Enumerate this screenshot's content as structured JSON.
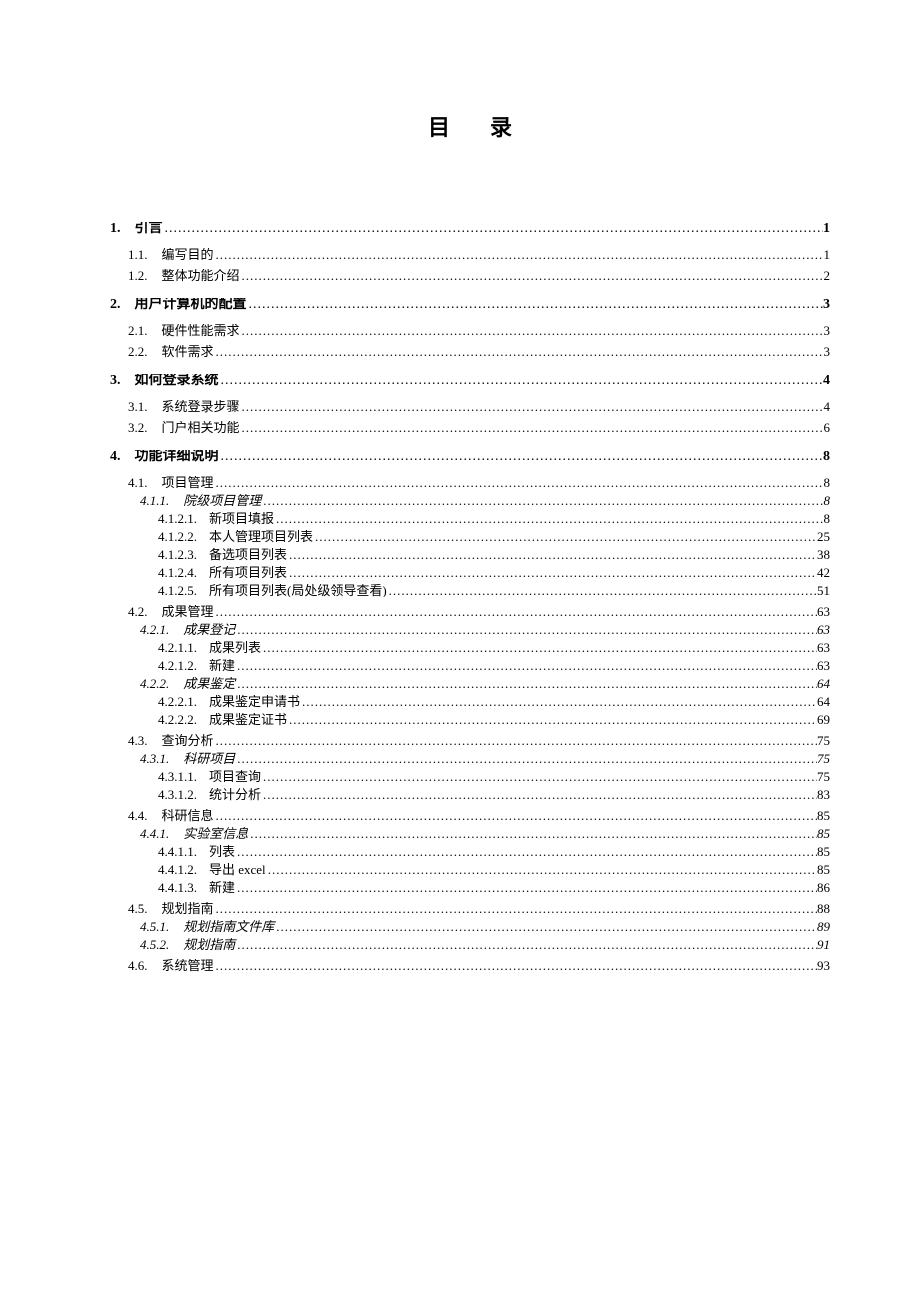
{
  "title": "目录",
  "entries": [
    {
      "level": 1,
      "num": "1.",
      "label": "引言",
      "page": "1"
    },
    {
      "level": 2,
      "num": "1.1.",
      "label": "编写目的",
      "page": "1"
    },
    {
      "level": 2,
      "num": "1.2.",
      "label": "整体功能介绍",
      "page": "2"
    },
    {
      "level": 1,
      "num": "2.",
      "label": "用户计算机的配置",
      "page": "3"
    },
    {
      "level": 2,
      "num": "2.1.",
      "label": "硬件性能需求",
      "page": "3"
    },
    {
      "level": 2,
      "num": "2.2.",
      "label": "软件需求",
      "page": "3"
    },
    {
      "level": 1,
      "num": "3.",
      "label": "如何登录系统",
      "page": "4"
    },
    {
      "level": 2,
      "num": "3.1.",
      "label": "系统登录步骤",
      "page": "4"
    },
    {
      "level": 2,
      "num": "3.2.",
      "label": "门户相关功能",
      "page": "6"
    },
    {
      "level": 1,
      "num": "4.",
      "label": "功能详细说明",
      "page": "8"
    },
    {
      "level": 2,
      "num": "4.1.",
      "label": "项目管理",
      "page": "8"
    },
    {
      "level": 3,
      "num": "4.1.1.",
      "label": "院级项目管理",
      "page": "8"
    },
    {
      "level": 4,
      "num": "4.1.2.1.",
      "label": "新项目填报",
      "page": "8"
    },
    {
      "level": 4,
      "num": "4.1.2.2.",
      "label": "本人管理项目列表",
      "page": "25"
    },
    {
      "level": 4,
      "num": "4.1.2.3.",
      "label": "备选项目列表",
      "page": "38"
    },
    {
      "level": 4,
      "num": "4.1.2.4.",
      "label": "所有项目列表",
      "page": "42"
    },
    {
      "level": 4,
      "num": "4.1.2.5.",
      "label": "所有项目列表(局处级领导查看)",
      "page": "51"
    },
    {
      "level": 2,
      "num": "4.2.",
      "label": "成果管理",
      "page": "63"
    },
    {
      "level": 3,
      "num": "4.2.1.",
      "label": "成果登记",
      "page": "63"
    },
    {
      "level": 4,
      "num": "4.2.1.1.",
      "label": "成果列表",
      "page": "63"
    },
    {
      "level": 4,
      "num": "4.2.1.2.",
      "label": "新建",
      "page": "63"
    },
    {
      "level": 3,
      "num": "4.2.2.",
      "label": "成果鉴定",
      "page": "64"
    },
    {
      "level": 4,
      "num": "4.2.2.1.",
      "label": "成果鉴定申请书",
      "page": "64"
    },
    {
      "level": 4,
      "num": "4.2.2.2.",
      "label": "成果鉴定证书",
      "page": "69"
    },
    {
      "level": 2,
      "num": "4.3.",
      "label": "查询分析",
      "page": "75"
    },
    {
      "level": 3,
      "num": "4.3.1.",
      "label": "科研项目",
      "page": "75"
    },
    {
      "level": 4,
      "num": "4.3.1.1.",
      "label": "项目查询",
      "page": "75"
    },
    {
      "level": 4,
      "num": "4.3.1.2.",
      "label": "统计分析",
      "page": "83"
    },
    {
      "level": 2,
      "num": "4.4.",
      "label": "科研信息",
      "page": "85"
    },
    {
      "level": 3,
      "num": "4.4.1.",
      "label": "实验室信息",
      "page": "85"
    },
    {
      "level": 4,
      "num": "4.4.1.1.",
      "label": "列表",
      "page": "85"
    },
    {
      "level": 4,
      "num": "4.4.1.2.",
      "label": "导出 excel",
      "page": "85"
    },
    {
      "level": 4,
      "num": "4.4.1.3.",
      "label": "新建",
      "page": "86"
    },
    {
      "level": 2,
      "num": "4.5.",
      "label": "规划指南",
      "page": "88"
    },
    {
      "level": 3,
      "num": "4.5.1.",
      "label": "规划指南文件库",
      "page": "89"
    },
    {
      "level": 3,
      "num": "4.5.2.",
      "label": "规划指南",
      "page": "91"
    },
    {
      "level": 2,
      "num": "4.6.",
      "label": "系统管理",
      "page": "93"
    }
  ]
}
